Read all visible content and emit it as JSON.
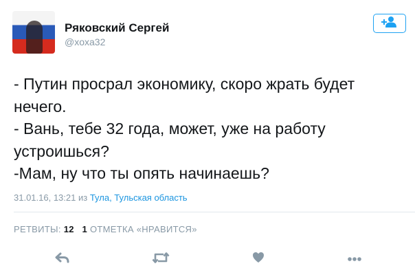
{
  "tweet": {
    "author_name": "Ряковский Сергей",
    "handle": "@xoxa32",
    "text": "- Путин просрал экономику, скоро жрать будет\nнечего.\n- Вань, тебе 32 года, может, уже на работу\nустроишься?\n-Мам, ну что ты опять начинаешь?",
    "timestamp": "31.01.16, 13:21",
    "location_prefix": "из",
    "location": "Тула, Тульская область"
  },
  "stats": {
    "retweets_label": "РЕТВИТЫ:",
    "retweets_count": "12",
    "likes_count": "1",
    "likes_label": "ОТМЕТКА «НРАВИТСЯ»"
  },
  "icons": {
    "follow": "add-user-icon",
    "reply": "reply-icon",
    "retweet": "retweet-icon",
    "like": "heart-icon",
    "more": "more-icon"
  },
  "colors": {
    "accent": "#1da1f2",
    "link": "#1b95e0",
    "muted": "#8899a6",
    "icon": "#8899a6"
  }
}
